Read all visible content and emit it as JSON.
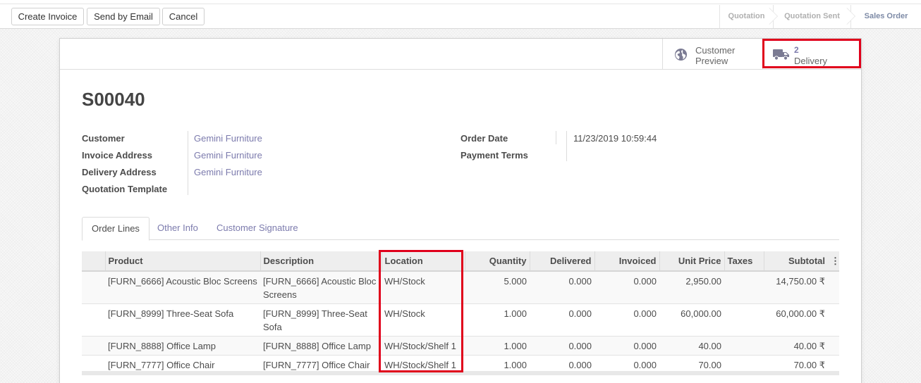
{
  "control_panel": {
    "buttons": {
      "create_invoice": "Create Invoice",
      "send_by_email": "Send by Email",
      "cancel": "Cancel"
    },
    "statusbar": [
      {
        "label": "Quotation",
        "active": false
      },
      {
        "label": "Quotation Sent",
        "active": false
      },
      {
        "label": "Sales Order",
        "active": true
      }
    ]
  },
  "smart_buttons": {
    "customer_preview": {
      "line1": "Customer",
      "line2": "Preview",
      "icon": "globe-icon"
    },
    "delivery": {
      "count": "2",
      "label": "Delivery",
      "icon": "truck-icon"
    }
  },
  "record": {
    "name": "S00040",
    "left_fields": [
      {
        "label": "Customer",
        "value": "Gemini Furniture"
      },
      {
        "label": "Invoice Address",
        "value": "Gemini Furniture"
      },
      {
        "label": "Delivery Address",
        "value": "Gemini Furniture"
      },
      {
        "label": "Quotation Template",
        "value": ""
      }
    ],
    "right_fields": [
      {
        "label": "Order Date",
        "value": "11/23/2019 10:59:44"
      },
      {
        "label": "Payment Terms",
        "value": ""
      }
    ]
  },
  "tabs": [
    "Order Lines",
    "Other Info",
    "Customer Signature"
  ],
  "order_lines": {
    "columns": [
      "Product",
      "Description",
      "Location",
      "Quantity",
      "Delivered",
      "Invoiced",
      "Unit Price",
      "Taxes",
      "Subtotal"
    ],
    "rows": [
      {
        "product": "[FURN_6666] Acoustic Bloc Screens",
        "description": "[FURN_6666] Acoustic Bloc Screens",
        "location": "WH/Stock",
        "quantity": "5.000",
        "delivered": "0.000",
        "invoiced": "0.000",
        "unit_price": "2,950.00",
        "taxes": "",
        "subtotal": "14,750.00 ₹"
      },
      {
        "product": "[FURN_8999] Three-Seat Sofa",
        "description": "[FURN_8999] Three-Seat Sofa",
        "location": "WH/Stock",
        "quantity": "1.000",
        "delivered": "0.000",
        "invoiced": "0.000",
        "unit_price": "60,000.00",
        "taxes": "",
        "subtotal": "60,000.00 ₹"
      },
      {
        "product": "[FURN_8888] Office Lamp",
        "description": "[FURN_8888] Office Lamp",
        "location": "WH/Stock/Shelf 1",
        "quantity": "1.000",
        "delivered": "0.000",
        "invoiced": "0.000",
        "unit_price": "40.00",
        "taxes": "",
        "subtotal": "40.00 ₹"
      },
      {
        "product": "[FURN_7777] Office Chair",
        "description": "[FURN_7777] Office Chair",
        "location": "WH/Stock/Shelf 1",
        "quantity": "1.000",
        "delivered": "0.000",
        "invoiced": "0.000",
        "unit_price": "70.00",
        "taxes": "",
        "subtotal": "70.00 ₹"
      }
    ]
  },
  "colors": {
    "link": "#7c7bad",
    "highlight": "#e0001b",
    "active_stage": "#7d8aa6"
  }
}
